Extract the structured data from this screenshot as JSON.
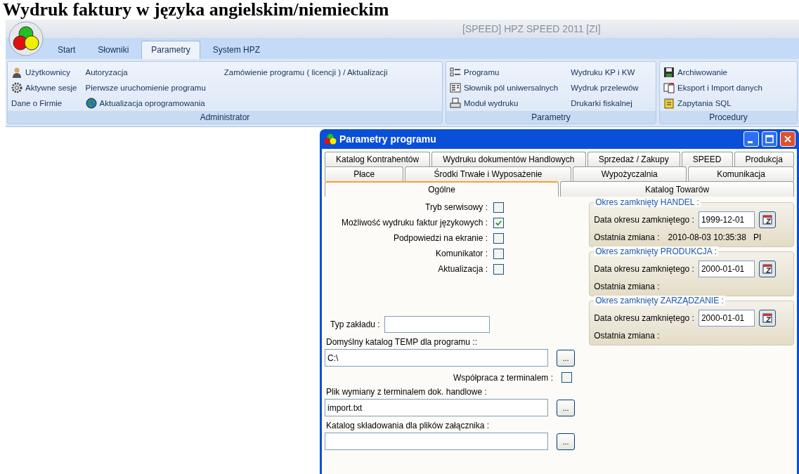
{
  "heading": "Wydruk faktury w języka angielskim/niemieckim",
  "app": {
    "title": "[SPEED] HPZ SPEED 2011 [ZI]"
  },
  "tabs": [
    {
      "label": "Start",
      "selected": false
    },
    {
      "label": "Słowniki",
      "selected": false
    },
    {
      "label": "Parametry",
      "selected": true
    },
    {
      "label": "System HPZ",
      "selected": false
    }
  ],
  "ribbon_groups": [
    {
      "title": "Administrator",
      "columns": [
        [
          {
            "label": "Użytkownicy"
          },
          {
            "label": "Aktywne sesje"
          },
          {
            "label": "Dane o Firmie"
          }
        ],
        [
          {
            "label": "Autoryzacja"
          },
          {
            "label": "Pierwsze uruchomienie programu"
          },
          {
            "label": "Aktualizacja oprogramowania"
          }
        ],
        [
          {
            "label": "Zamówienie programu ( licencji ) / Aktualizacji"
          }
        ]
      ]
    },
    {
      "title": "Parametry",
      "columns": [
        [
          {
            "label": "Programu"
          },
          {
            "label": "Słownik pól uniwersalnych"
          },
          {
            "label": "Moduł wydruku"
          }
        ],
        [
          {
            "label": "Wydruku KP i KW"
          },
          {
            "label": "Wydruk przelewów"
          },
          {
            "label": "Drukarki fiskalnej"
          }
        ]
      ]
    },
    {
      "title": "Procedury",
      "columns": [
        [
          {
            "label": "Archiwowanie"
          },
          {
            "label": "Eksport i Import danych"
          },
          {
            "label": "Zapytania SQL"
          }
        ]
      ]
    }
  ],
  "dialog": {
    "title": "Parametry programu",
    "tab_rows": [
      [
        {
          "label": "Katalog Kontrahentów",
          "selected": false
        },
        {
          "label": "Wydruku dokumentów Handlowych",
          "selected": false
        },
        {
          "label": "Sprzedaż / Zakupy",
          "selected": false
        },
        {
          "label": "SPEED",
          "selected": false
        },
        {
          "label": "Produkcja",
          "selected": false
        }
      ],
      [
        {
          "label": "Płace",
          "selected": false
        },
        {
          "label": "Środki Trwałe i Wyposażenie",
          "selected": false
        },
        {
          "label": "Wypożyczalnia",
          "selected": false
        },
        {
          "label": "Komunikacja",
          "selected": false
        }
      ],
      [
        {
          "label": "Ogólne",
          "selected": true
        },
        {
          "label": "Katalog Towarów",
          "selected": false
        }
      ]
    ],
    "checkboxes": [
      {
        "label": "Tryb serwisowy :",
        "checked": false
      },
      {
        "label": "Możliwość wydruku faktur językowych :",
        "checked": true
      },
      {
        "label": "Podpowiedzi na ekranie :",
        "checked": false
      },
      {
        "label": "Komunikator :",
        "checked": false
      },
      {
        "label": "Aktualizacja :",
        "checked": false
      }
    ],
    "periods": [
      {
        "title": "Okres zamknięty HANDEL :",
        "date_label": "Data okresu zamkniętego :",
        "date": "1999-12-01",
        "last_change_label": "Ostatnia zmiana :",
        "last_change": "2010-08-03 10:35:38   PI"
      },
      {
        "title": "Okres zamknięty PRODUKCJA :",
        "date_label": "Data okresu zamkniętego :",
        "date": "2000-01-01",
        "last_change_label": "Ostatnia zmiana :"
      },
      {
        "title": "Okres zamknięty ZARZĄDZANIE :",
        "date_label": "Data okresu zamkniętego :",
        "date": "2000-01-01",
        "last_change_label": "Ostatnia zmiana :"
      }
    ],
    "plant_type": {
      "label": "Typ zakładu :"
    },
    "lower_fields": [
      {
        "kind": "path",
        "label": "Domyślny katalog TEMP dla programu ::",
        "value": "C:\\",
        "button": "..."
      },
      {
        "kind": "checkbox",
        "label": "Współpraca z terminalem :",
        "checked": false
      },
      {
        "kind": "path",
        "label": "Plik wymiany z terminalem dok. handlowe :",
        "value": "import.txt",
        "button": "..."
      },
      {
        "kind": "path",
        "label": "Katalog składowania dla plików załącznika :",
        "button": "..."
      }
    ]
  }
}
